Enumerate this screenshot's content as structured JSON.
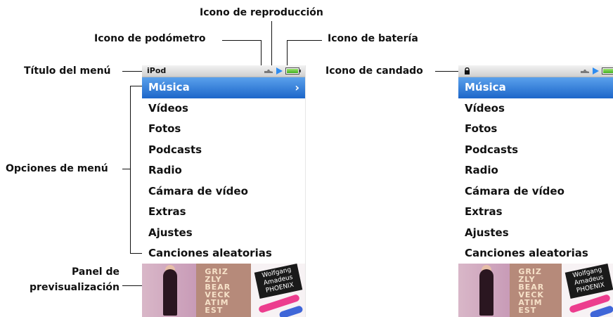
{
  "callouts": {
    "playback_icon": "Icono de reproducción",
    "pedometer_icon": "Icono de podómetro",
    "battery_icon": "Icono de batería",
    "menu_title": "Título del menú",
    "lock_icon": "Icono de candado",
    "menu_options": "Opciones de menú",
    "preview_panel_line1": "Panel de",
    "preview_panel_line2": "previsualización"
  },
  "screen_left": {
    "title": "iPod",
    "selected_chevron": "›",
    "items": [
      {
        "label": "Música",
        "selected": true
      },
      {
        "label": "Vídeos"
      },
      {
        "label": "Fotos"
      },
      {
        "label": "Podcasts"
      },
      {
        "label": "Radio"
      },
      {
        "label": "Cámara de vídeo"
      },
      {
        "label": "Extras"
      },
      {
        "label": "Ajustes"
      },
      {
        "label": "Canciones aleatorias"
      }
    ],
    "icons": [
      "pedometer-icon",
      "play-icon",
      "battery-icon"
    ]
  },
  "screen_right": {
    "items": [
      {
        "label": "Música",
        "selected": true
      },
      {
        "label": "Vídeos"
      },
      {
        "label": "Fotos"
      },
      {
        "label": "Podcasts"
      },
      {
        "label": "Radio"
      },
      {
        "label": "Cámara de vídeo"
      },
      {
        "label": "Extras"
      },
      {
        "label": "Ajustes"
      },
      {
        "label": "Canciones aleatorias"
      }
    ],
    "icons": [
      "lock-icon",
      "pedometer-icon",
      "play-icon",
      "battery-icon"
    ]
  },
  "preview": {
    "cover2_text": [
      "GRIZ",
      "ZLY",
      "BEAR",
      "VECK",
      "ATIM",
      "EST"
    ],
    "cover3_text": "Wolfgang Amadeus PHOENIX"
  },
  "colors": {
    "selection_top": "#5aa1ec",
    "selection_bottom": "#1d66c9",
    "play": "#2e8cf0",
    "battery": "#3fae1f"
  }
}
